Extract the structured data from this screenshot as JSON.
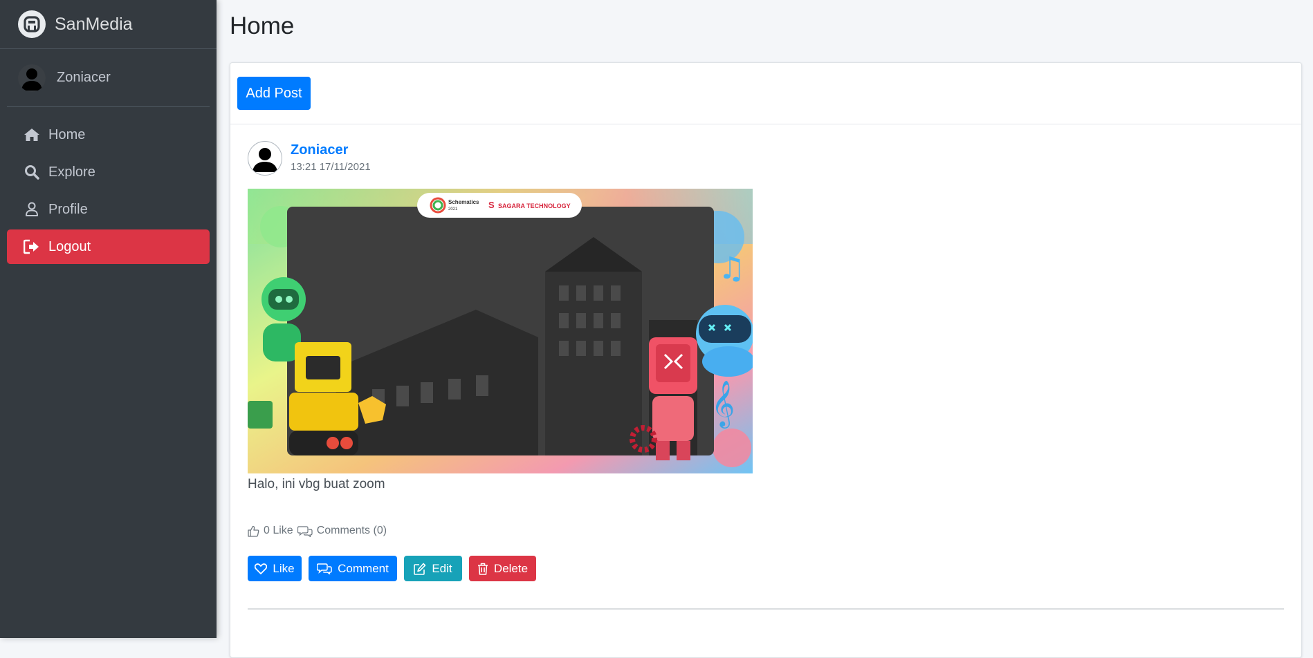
{
  "brand": {
    "name": "SanMedia",
    "logo_icon": "brand-logo-icon"
  },
  "user": {
    "name": "Zoniacer"
  },
  "nav": {
    "items": [
      {
        "label": "Home",
        "icon": "home-icon"
      },
      {
        "label": "Explore",
        "icon": "search-icon"
      },
      {
        "label": "Profile",
        "icon": "user-icon"
      },
      {
        "label": "Logout",
        "icon": "logout-icon",
        "active": true
      }
    ]
  },
  "page": {
    "title": "Home"
  },
  "toolbar": {
    "add_post_label": "Add Post"
  },
  "post": {
    "author": "Zoniacer",
    "time": "13:21 17/11/2021",
    "image_banner": {
      "left_logo_text": "Schematics",
      "left_logo_sub": "2021",
      "right_logo_text": "SAGARA TECHNOLOGY"
    },
    "text": "Halo, ini vbg buat zoom",
    "stats": {
      "likes": "0 Like",
      "comments": "Comments (0)"
    },
    "actions": {
      "like": "Like",
      "comment": "Comment",
      "edit": "Edit",
      "delete": "Delete"
    }
  },
  "colors": {
    "sidebar_bg": "#343a40",
    "primary": "#007bff",
    "info": "#17a2b8",
    "danger": "#dc3545"
  }
}
